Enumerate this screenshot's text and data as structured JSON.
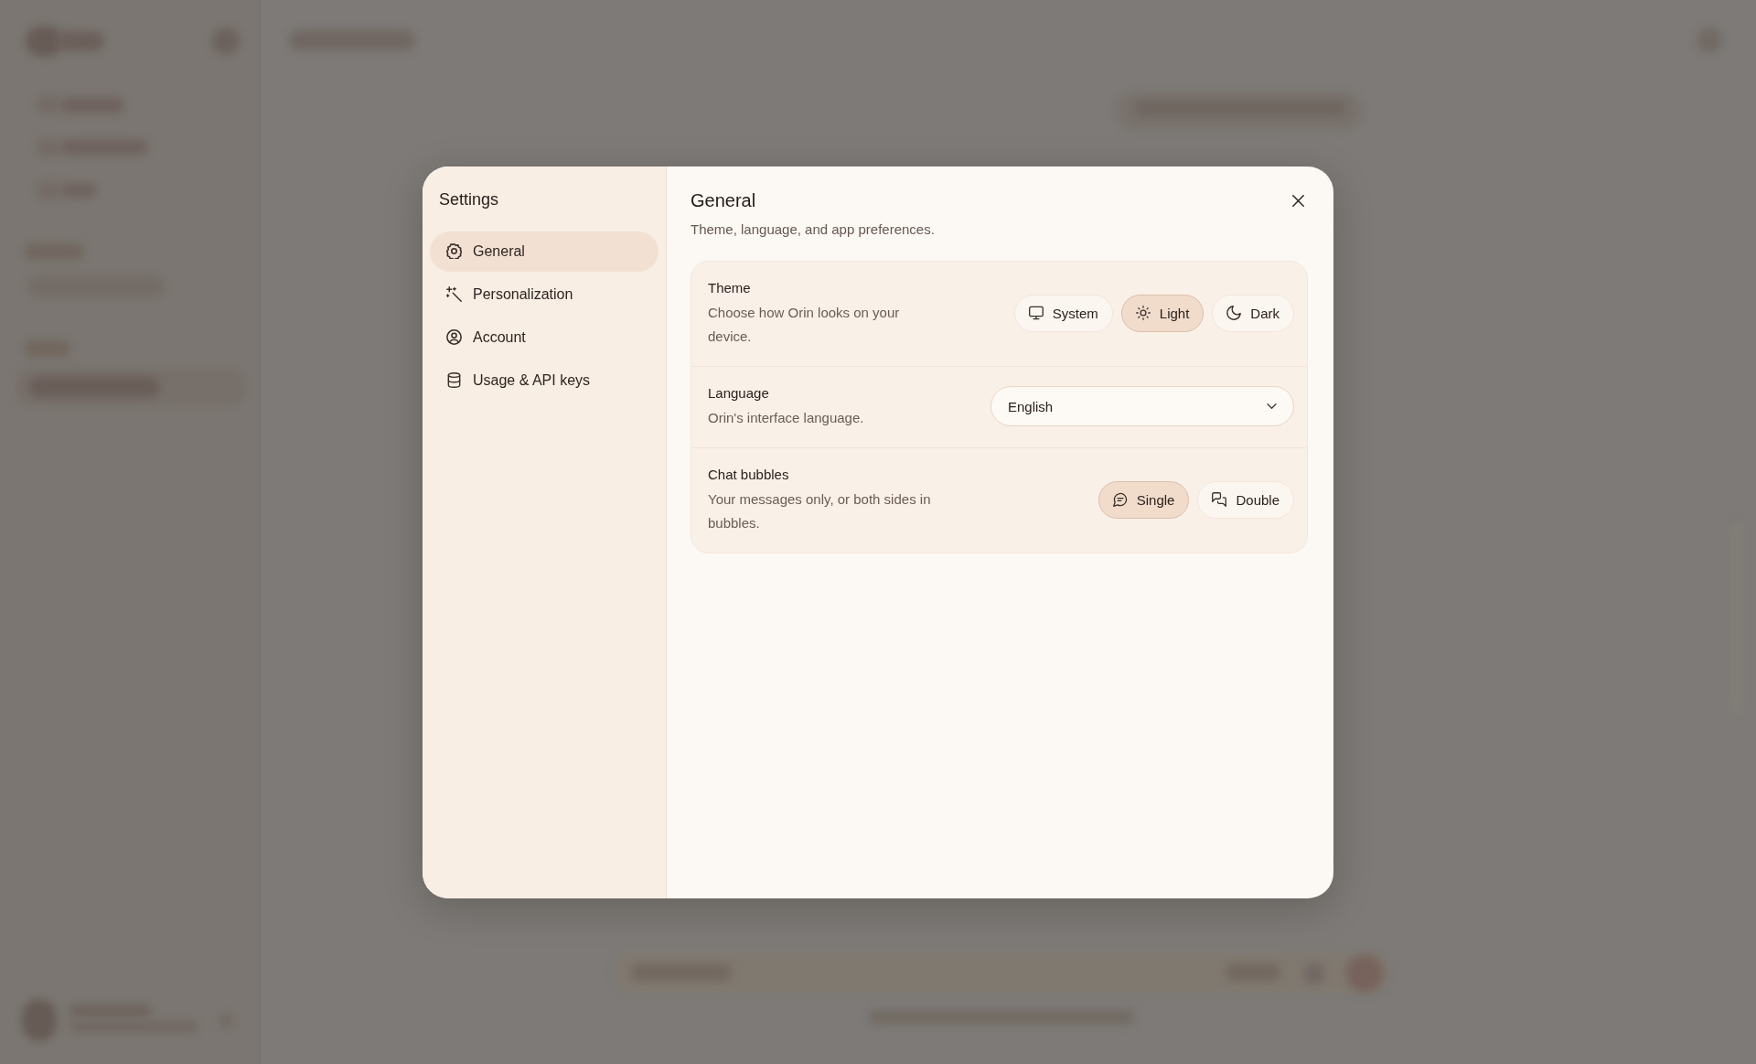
{
  "settings": {
    "title": "Settings",
    "nav": [
      {
        "label": "General",
        "selected": true
      },
      {
        "label": "Personalization",
        "selected": false
      },
      {
        "label": "Account",
        "selected": false
      },
      {
        "label": "Usage & API keys",
        "selected": false
      }
    ]
  },
  "panel": {
    "title": "General",
    "subtitle": "Theme, language, and app preferences."
  },
  "rows": [
    {
      "kind": "options",
      "label": "Theme",
      "description": "Choose how Orin looks on your device.",
      "options": [
        {
          "label": "System",
          "selected": false
        },
        {
          "label": "Light",
          "selected": true
        },
        {
          "label": "Dark",
          "selected": false
        }
      ]
    },
    {
      "kind": "select",
      "label": "Language",
      "description": "Orin's interface language.",
      "value": "English"
    },
    {
      "kind": "options",
      "label": "Chat bubbles",
      "description": "Your messages only, or both sides in bubbles.",
      "options": [
        {
          "label": "Single",
          "selected": true
        },
        {
          "label": "Double",
          "selected": false
        }
      ]
    }
  ]
}
